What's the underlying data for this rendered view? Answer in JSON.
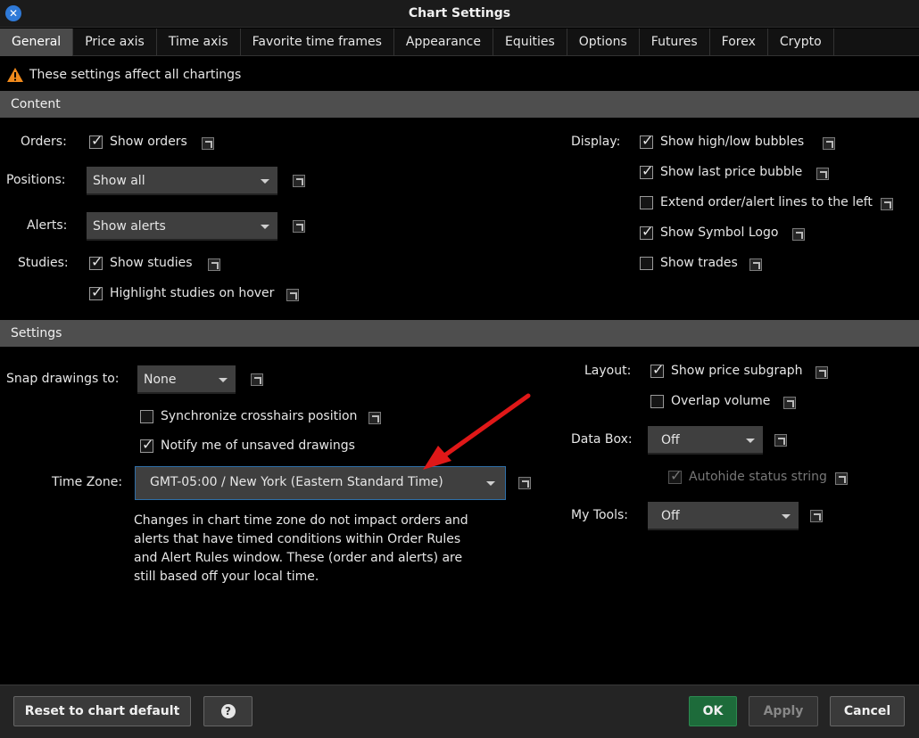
{
  "window": {
    "title": "Chart Settings"
  },
  "tabs": [
    "General",
    "Price axis",
    "Time axis",
    "Favorite time frames",
    "Appearance",
    "Equities",
    "Options",
    "Futures",
    "Forex",
    "Crypto"
  ],
  "notice": "These settings affect all chartings",
  "content": {
    "header": "Content",
    "orders_label": "Orders:",
    "show_orders": "Show orders",
    "positions_label": "Positions:",
    "positions_value": "Show all",
    "alerts_label": "Alerts:",
    "alerts_value": "Show alerts",
    "studies_label": "Studies:",
    "show_studies": "Show studies",
    "highlight_studies": "Highlight studies on hover",
    "display_label": "Display:",
    "show_high_low": "Show high/low bubbles",
    "show_last_price": "Show last price bubble",
    "extend_lines": "Extend order/alert lines to the left",
    "show_symbol_logo": "Show Symbol Logo",
    "show_trades": "Show trades"
  },
  "settings": {
    "header": "Settings",
    "snap_label": "Snap drawings to:",
    "snap_value": "None",
    "sync_crosshairs": "Synchronize crosshairs position",
    "notify_unsaved": "Notify me of unsaved drawings",
    "timezone_label": "Time Zone:",
    "timezone_value": "GMT-05:00 / New York (Eastern Standard Time)",
    "timezone_note": "Changes in chart time zone do not impact orders and alerts that have timed conditions within Order Rules and Alert Rules window. These (order and alerts) are still based off your local time.",
    "layout_label": "Layout:",
    "show_price_subgraph": "Show price subgraph",
    "overlap_volume": "Overlap volume",
    "databox_label": "Data Box:",
    "databox_value": "Off",
    "autohide_status": "Autohide status string",
    "mytools_label": "My Tools:",
    "mytools_value": "Off"
  },
  "footer": {
    "reset": "Reset to chart default",
    "help": "?",
    "ok": "OK",
    "apply": "Apply",
    "cancel": "Cancel"
  },
  "colors": {
    "arrow": "#e01818",
    "ok_button": "#1d6b3a",
    "focus_border": "#2f6fa8",
    "warning": "#f08a1c"
  }
}
